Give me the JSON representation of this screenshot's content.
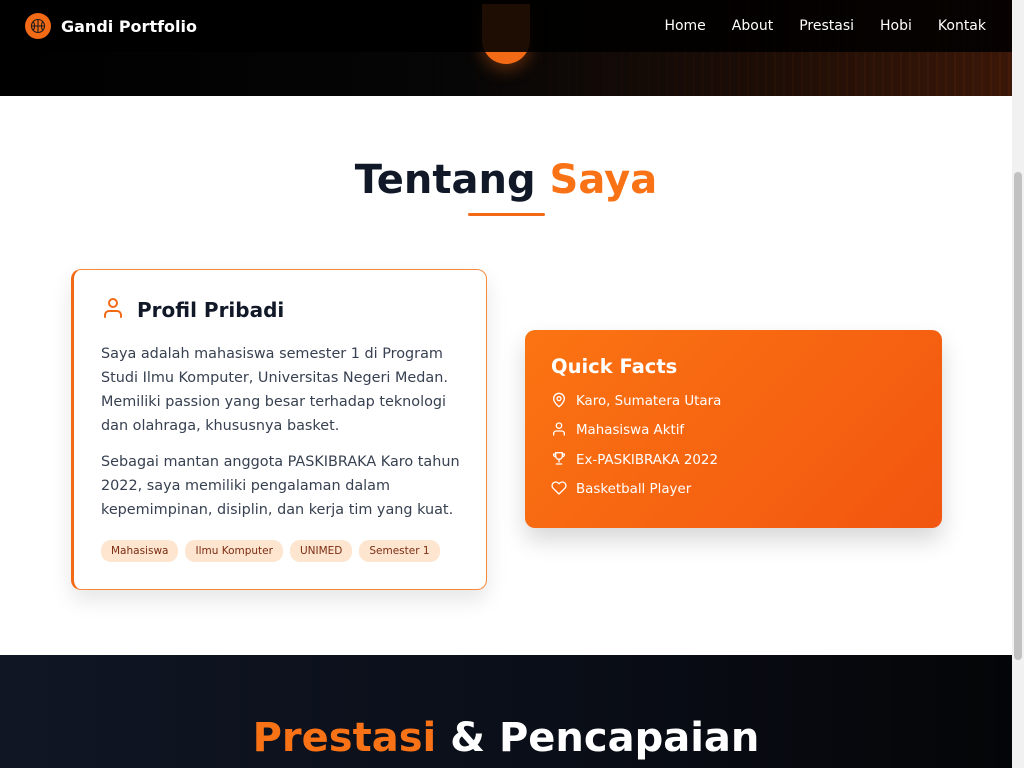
{
  "nav": {
    "brand": "Gandi Portfolio",
    "links": [
      "Home",
      "About",
      "Prestasi",
      "Hobi",
      "Kontak"
    ]
  },
  "about": {
    "title_main": "Tentang",
    "title_accent": "Saya",
    "profile": {
      "title": "Profil Pribadi",
      "paragraph1": "Saya adalah mahasiswa semester 1 di Program Studi Ilmu Komputer, Universitas Negeri Medan. Memiliki passion yang besar terhadap teknologi dan olahraga, khususnya basket.",
      "paragraph2": "Sebagai mantan anggota PASKIBRAKA Karo tahun 2022, saya memiliki pengalaman dalam kepemimpinan, disiplin, dan kerja tim yang kuat.",
      "tags": [
        "Mahasiswa",
        "Ilmu Komputer",
        "UNIMED",
        "Semester 1"
      ]
    },
    "facts": {
      "title": "Quick Facts",
      "items": [
        {
          "icon": "map-pin-icon",
          "text": "Karo, Sumatera Utara"
        },
        {
          "icon": "user-icon",
          "text": "Mahasiswa Aktif"
        },
        {
          "icon": "trophy-icon",
          "text": "Ex-PASKIBRAKA 2022"
        },
        {
          "icon": "heart-icon",
          "text": "Basketball Player"
        }
      ]
    }
  },
  "prestasi": {
    "title_accent": "Prestasi",
    "title_rest": " & Pencapaian"
  },
  "colors": {
    "accent": "#f97316",
    "dark": "#0b0f19"
  }
}
